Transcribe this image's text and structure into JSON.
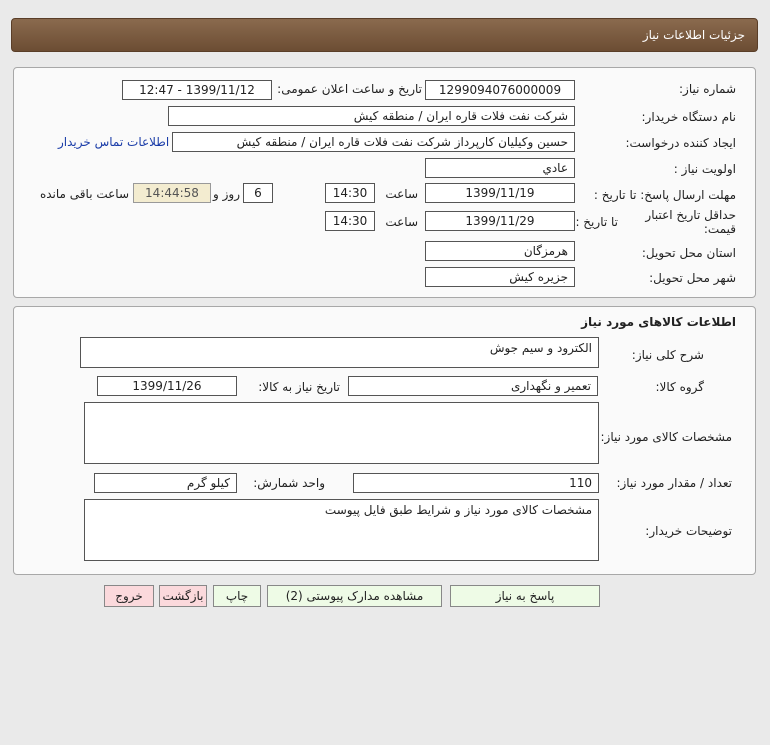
{
  "header": {
    "title": "جزئیات اطلاعات نیاز"
  },
  "details": {
    "need_number_label": "شماره نیاز:",
    "need_number": "1299094076000009",
    "announce_label": "تاریخ و ساعت اعلان عمومی:",
    "announce_value": "1399/11/12 - 12:47",
    "buyer_org_label": "نام دستگاه خریدار:",
    "buyer_org": "شرکت نفت فلات قاره ایران / منطقه کیش",
    "requester_label": "ایجاد کننده درخواست:",
    "requester": "حسین وکیلیان کارپرداز شرکت نفت فلات قاره ایران / منطقه کیش",
    "contact_link": "اطلاعات تماس خریدار",
    "priority_label": "اولویت نیاز :",
    "priority": "عادي",
    "deadline_label": "مهلت ارسال پاسخ: تا تاریخ :",
    "deadline_date": "1399/11/19",
    "time_label": "ساعت",
    "deadline_time": "14:30",
    "days": "6",
    "days_label": "روز و",
    "remaining_time": "14:44:58",
    "remaining_label": "ساعت باقی مانده",
    "validity_label": "حداقل تاریخ اعتبار قیمت:",
    "validity_to_label": "تا تاریخ :",
    "validity_date": "1399/11/29",
    "validity_time_label": "ساعت",
    "validity_time": "14:30",
    "province_label": "استان محل تحویل:",
    "province": "هرمزگان",
    "city_label": "شهر محل تحویل:",
    "city": "جزیره کیش"
  },
  "goods": {
    "section_title": "اطلاعات کالاهای مورد نیاز",
    "general_desc_label": "شرح کلی نیاز:",
    "general_desc": "الکترود و سیم جوش",
    "group_label": "گروه کالا:",
    "group": "تعمیر و نگهداری",
    "need_date_label": "تاریخ نیاز به کالا:",
    "need_date": "1399/11/26",
    "specs_label": "مشخصات کالای مورد نیاز:",
    "specs": "",
    "qty_label": "تعداد / مقدار مورد نیاز:",
    "qty": "110",
    "unit_label": "واحد شمارش:",
    "unit": "کیلو گرم",
    "buyer_notes_label": "توضیحات خریدار:",
    "buyer_notes": "مشخصات کالای مورد نیاز و شرایط طبق فایل پیوست"
  },
  "buttons": {
    "respond": "پاسخ به نیاز",
    "attachments": "مشاهده مدارک پیوستی (2)",
    "print": "چاپ",
    "back": "بازگشت",
    "exit": "خروج"
  }
}
